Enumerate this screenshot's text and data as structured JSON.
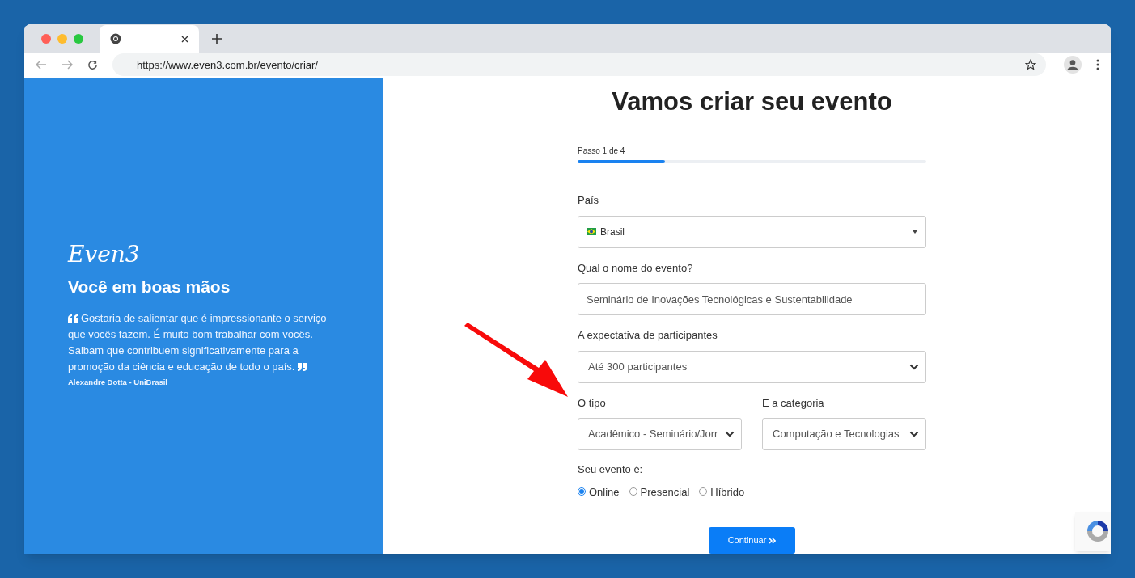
{
  "browser": {
    "url": "https://www.even3.com.br/evento/criar/"
  },
  "sidebar": {
    "logo": "Even3",
    "heading": "Você em boas mãos",
    "quote": "Gostaria de salientar que é impressionante o serviço que vocês fazem. É muito bom trabalhar com vocês. Saibam que contribuem significativamente para a promoção da ciência e educação de todo o país.",
    "author": "Alexandre Dotta - UniBrasil"
  },
  "form": {
    "title": "Vamos criar seu evento",
    "progress": {
      "label": "Passo 1 de 4",
      "level": 0.25
    },
    "country": {
      "label": "País",
      "value": "Brasil"
    },
    "name": {
      "label": "Qual o nome do evento?",
      "value": "Seminário de Inovações Tecnológicas e Sustentabilidade"
    },
    "participants": {
      "label": "A expectativa de participantes",
      "value": "Até 300 participantes"
    },
    "type": {
      "label": "O tipo",
      "value": "Acadêmico - Seminário/Jorr"
    },
    "category": {
      "label": "E a categoria",
      "value": "Computação e Tecnologias"
    },
    "mode": {
      "label": "Seu evento é:",
      "options": [
        {
          "label": "Online",
          "selected": true
        },
        {
          "label": "Presencial",
          "selected": false
        },
        {
          "label": "Híbrido",
          "selected": false
        }
      ]
    },
    "submit": "Continuar"
  }
}
